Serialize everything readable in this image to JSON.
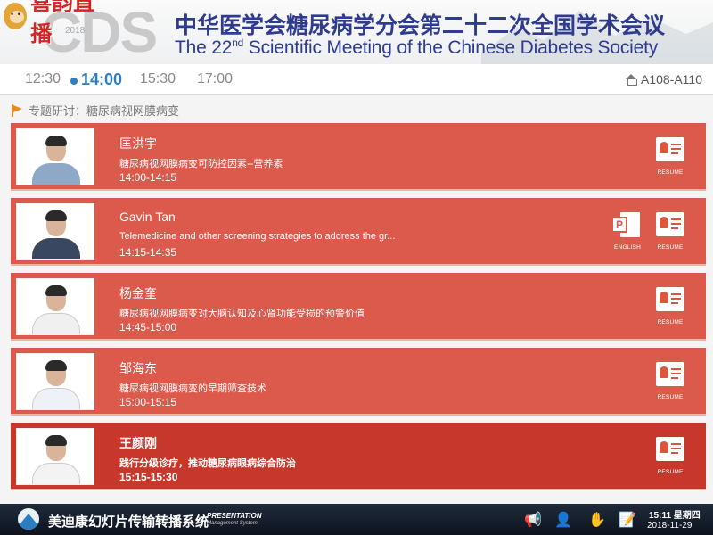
{
  "watermark": {
    "text": "喜韵直播"
  },
  "header": {
    "logo_text": "CDS",
    "logo_year": "2018",
    "title_cn": "中华医学会糖尿病学分会第二十二次全国学术会议",
    "title_en_pre": "The 22",
    "title_en_sup": "nd",
    "title_en_post": " Scientific Meeting of the Chinese Diabetes Society"
  },
  "timebar": {
    "times": [
      "12:30",
      "14:00",
      "15:30",
      "17:00"
    ],
    "active_index": 1,
    "room": "A108-A110"
  },
  "session": {
    "label": "专题研讨：糖尿病视网膜病变"
  },
  "speakers": [
    {
      "name": "匡洪宇",
      "topic": "糖尿病视网膜病变可防控因素--营养素",
      "time": "14:00-14:15",
      "english": false
    },
    {
      "name": "Gavin Tan",
      "topic": "Telemedicine and other screening strategies to address the gr...",
      "time": "14:15-14:35",
      "english": true
    },
    {
      "name": "杨金奎",
      "topic": "糖尿病视网膜病变对大脑认知及心肾功能受损的预警价值",
      "time": "14:45-15:00",
      "english": false
    },
    {
      "name": "邹海东",
      "topic": "糖尿病视网膜病变的早期筛查技术",
      "time": "15:00-15:15",
      "english": false
    },
    {
      "name": "王颜刚",
      "topic": "践行分级诊疗，推动糖尿病眼病综合防治",
      "time": "15:15-15:30",
      "english": false
    }
  ],
  "buttons": {
    "resume": "RESUME",
    "english": "ENGLISH",
    "ppt_letter": "P"
  },
  "taskbar": {
    "title": "美迪康幻灯片传输转播系统",
    "sub1": "PRESENTATION",
    "sub2": "Management System",
    "time": "15:11 星期四",
    "date": "2018-11-29"
  },
  "colors": {
    "card": "#db5a4c",
    "card_active": "#c8372c",
    "accent_blue": "#2e7fc2",
    "title_blue": "#2f3b8e"
  }
}
